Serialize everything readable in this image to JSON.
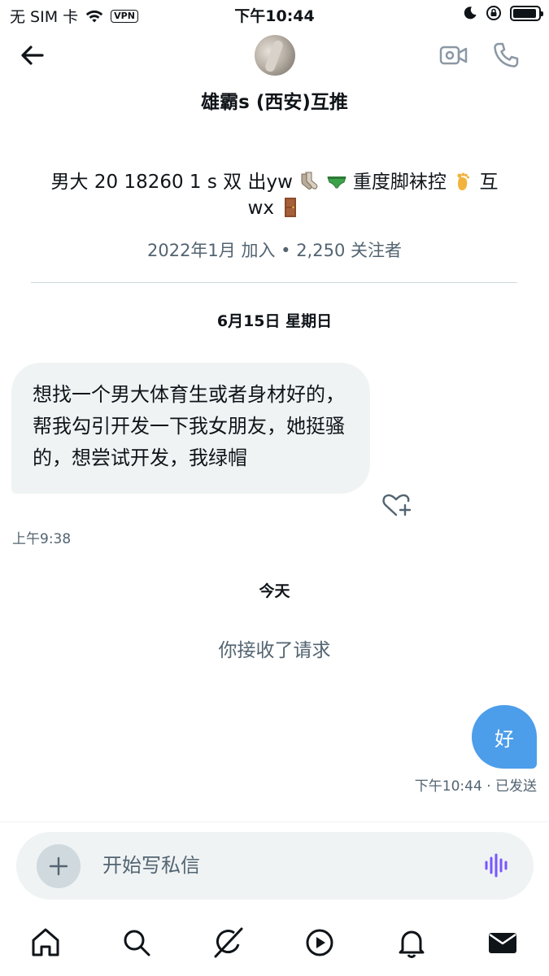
{
  "status_bar": {
    "carrier": "无 SIM 卡",
    "vpn": "VPN",
    "time": "下午10:44",
    "battery_level": 0.92
  },
  "header": {
    "name": "雄霸s (西安)互推"
  },
  "profile": {
    "bio_line1": "男大 20 18260 1 s 双 出yw",
    "bio_mid": "重度脚袜控",
    "bio_end": "互",
    "bio_line2": "wx",
    "meta": "2022年1月 加入 • 2,250 关注者"
  },
  "conversation": {
    "date_separator_1": "6月15日 星期日",
    "incoming_message": "想找一个男大体育生或者身材好的，帮我勾引开发一下我女朋友，她挺骚的，想尝试开发，我绿帽",
    "incoming_time": "上午9:38",
    "date_separator_2": "今天",
    "system_message": "你接收了请求",
    "outgoing_message": "好",
    "outgoing_time": "下午10:44 · 已发送"
  },
  "composer": {
    "placeholder": "开始写私信"
  },
  "icons": {
    "back": "arrow-left-icon",
    "video": "video-camera-icon",
    "call": "phone-icon",
    "react": "heart-plus-icon",
    "add": "plus-icon",
    "voice": "voice-wave-icon",
    "tabs": [
      "home-icon",
      "search-icon",
      "grok-icon",
      "play-icon",
      "bell-icon",
      "mail-icon"
    ]
  },
  "colors": {
    "accent": "#4c9dea",
    "voice_icon": "#7856ff",
    "muted_text": "#536471",
    "bubble_gray": "#eff3f4"
  }
}
